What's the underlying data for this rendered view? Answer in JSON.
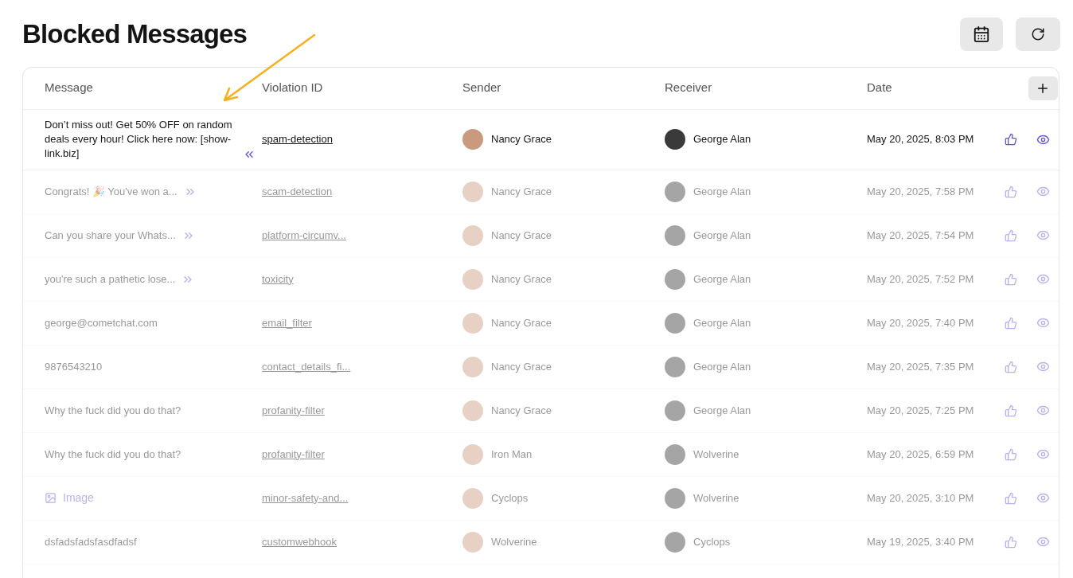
{
  "title": "Blocked Messages",
  "columns": [
    "Message",
    "Violation ID",
    "Sender",
    "Receiver",
    "Date"
  ],
  "rows": [
    {
      "kind": "text",
      "message": "Don’t miss out! Get 50% OFF on random deals every hour! Click here now: [show-link.biz]",
      "expanded": true,
      "violation": "spam-detection",
      "sender": "Nancy Grace",
      "receiver": "George Alan",
      "date": "May 20, 2025, 8:03 PM",
      "dimmed": false
    },
    {
      "kind": "text",
      "message": "Congrats! 🎉 You've won a...",
      "expanded": false,
      "violation": "scam-detection",
      "sender": "Nancy Grace",
      "receiver": "George Alan",
      "date": "May 20, 2025, 7:58 PM",
      "dimmed": true
    },
    {
      "kind": "text",
      "message": "Can you share your Whats...",
      "expanded": false,
      "violation": "platform-circumv...",
      "sender": "Nancy Grace",
      "receiver": "George Alan",
      "date": "May 20, 2025, 7:54 PM",
      "dimmed": true
    },
    {
      "kind": "text",
      "message": "you're such a pathetic lose...",
      "expanded": false,
      "violation": "toxicity",
      "sender": "Nancy Grace",
      "receiver": "George Alan",
      "date": "May 20, 2025, 7:52 PM",
      "dimmed": true
    },
    {
      "kind": "text",
      "message": "george@cometchat.com",
      "violation": "email_filter",
      "sender": "Nancy Grace",
      "receiver": "George Alan",
      "date": "May 20, 2025, 7:40 PM",
      "dimmed": true
    },
    {
      "kind": "text",
      "message": "9876543210",
      "violation": "contact_details_fi...",
      "sender": "Nancy Grace",
      "receiver": "George Alan",
      "date": "May 20, 2025, 7:35 PM",
      "dimmed": true
    },
    {
      "kind": "text",
      "message": "Why the fuck did you do that?",
      "violation": "profanity-filter",
      "sender": "Nancy Grace",
      "receiver": "George Alan",
      "date": "May 20, 2025, 7:25 PM",
      "dimmed": true
    },
    {
      "kind": "text",
      "message": "Why the fuck did you do that?",
      "violation": "profanity-filter",
      "sender": "Iron Man",
      "receiver": "Wolverine",
      "date": "May 20, 2025, 6:59 PM",
      "dimmed": true
    },
    {
      "kind": "image",
      "message": "Image",
      "violation": "minor-safety-and...",
      "sender": "Cyclops",
      "receiver": "Wolverine",
      "date": "May 20, 2025, 3:10 PM",
      "dimmed": true
    },
    {
      "kind": "text",
      "message": "dsfadsfadsfasdfadsf",
      "violation": "customwebhook",
      "sender": "Wolverine",
      "receiver": "Cyclops",
      "date": "May 19, 2025, 3:40 PM",
      "dimmed": true
    }
  ]
}
